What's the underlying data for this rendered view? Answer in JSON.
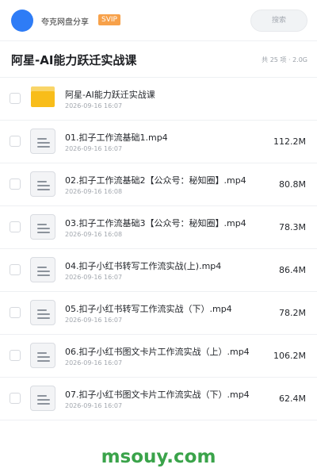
{
  "header": {
    "share_name": "夸克网盘分享",
    "badge": "SVIP",
    "search_placeholder": "搜索"
  },
  "folder": {
    "title": "阿星-AI能力跃迁实战课",
    "meta": "共 25 项 · 2.0G"
  },
  "items": [
    {
      "type": "folder",
      "name": "阿星-AI能力跃迁实战课",
      "date": "2026-09-16 16:07",
      "size": ""
    },
    {
      "type": "file",
      "name": "01.扣子工作流基础1.mp4",
      "date": "2026-09-16 16:07",
      "size": "112.2M"
    },
    {
      "type": "file",
      "name": "02.扣子工作流基础2【公众号：秘知圈】.mp4",
      "date": "2026-09-16 16:08",
      "size": "80.8M"
    },
    {
      "type": "file",
      "name": "03.扣子工作流基础3【公众号：秘知圈】.mp4",
      "date": "2026-09-16 16:08",
      "size": "78.3M"
    },
    {
      "type": "file",
      "name": "04.扣子小红书转写工作流实战(上).mp4",
      "date": "2026-09-16 16:07",
      "size": "86.4M"
    },
    {
      "type": "file",
      "name": "05.扣子小红书转写工作流实战（下）.mp4",
      "date": "2026-09-16 16:07",
      "size": "78.2M"
    },
    {
      "type": "file",
      "name": "06.扣子小红书图文卡片工作流实战（上）.mp4",
      "date": "2026-09-16 16:07",
      "size": "106.2M"
    },
    {
      "type": "file",
      "name": "07.扣子小红书图文卡片工作流实战（下）.mp4",
      "date": "2026-09-16 16:07",
      "size": "62.4M"
    }
  ],
  "icons": {
    "folder": "folder-icon",
    "file": "document-icon"
  },
  "colors": {
    "accent": "#2e7cf6",
    "badge": "#f7a14a",
    "folder": "#f8bd1a",
    "watermark": "#3aa34a"
  },
  "watermark": "msouy.com"
}
